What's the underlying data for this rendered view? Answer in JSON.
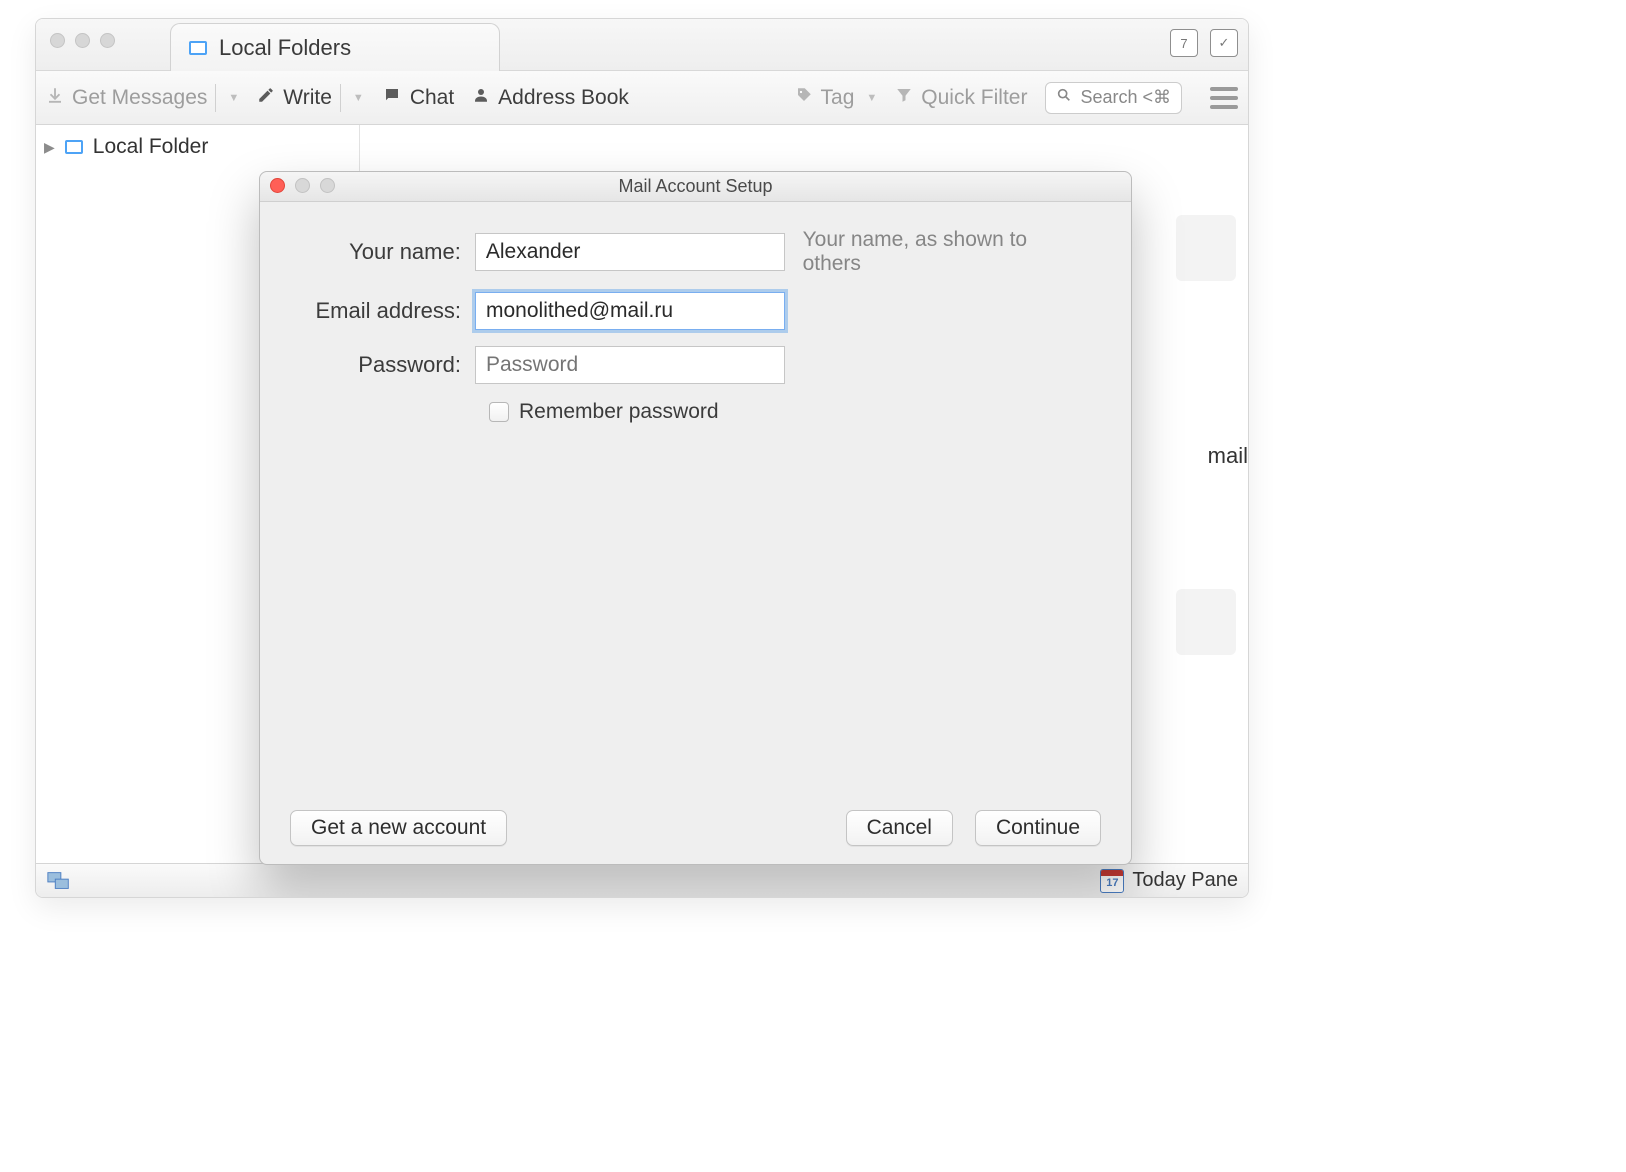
{
  "tab": {
    "title": "Local Folders"
  },
  "toolbar": {
    "get_messages": "Get Messages",
    "write": "Write",
    "chat": "Chat",
    "address_book": "Address Book",
    "tag": "Tag",
    "quick_filter": "Quick Filter",
    "search_placeholder": "Search <⌘"
  },
  "sidebar": {
    "items": [
      {
        "label": "Local Folder"
      }
    ]
  },
  "main": {
    "visible_text_fragment": "mail"
  },
  "statusbar": {
    "today_pane": "Today Pane",
    "calendar_day": "17"
  },
  "modal": {
    "title": "Mail Account Setup",
    "labels": {
      "your_name": "Your name:",
      "email": "Email address:",
      "password": "Password:"
    },
    "values": {
      "your_name": "Alexander",
      "email": "monolithed@mail.ru",
      "password": ""
    },
    "placeholders": {
      "password": "Password"
    },
    "hint_name": "Your name, as shown to others",
    "remember_password": "Remember password",
    "buttons": {
      "get_account": "Get a new account",
      "cancel": "Cancel",
      "continue": "Continue"
    }
  }
}
